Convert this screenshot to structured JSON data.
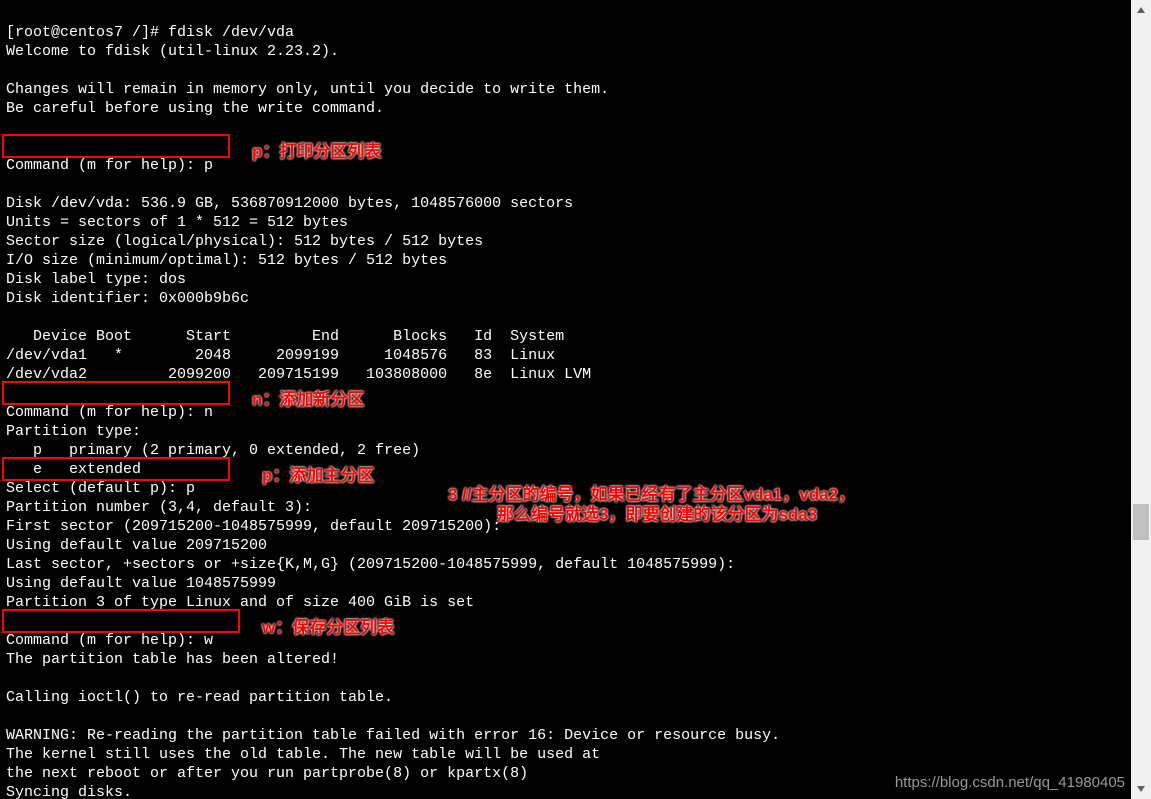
{
  "terminal": {
    "l1": "[root@centos7 /]# fdisk /dev/vda",
    "l2": "Welcome to fdisk (util-linux 2.23.2).",
    "l3": "",
    "l4": "Changes will remain in memory only, until you decide to write them.",
    "l5": "Be careful before using the write command.",
    "l6": "",
    "l7": "",
    "l8": "Command (m for help): p ",
    "l9": "",
    "l10": "Disk /dev/vda: 536.9 GB, 536870912000 bytes, 1048576000 sectors",
    "l11": "Units = sectors of 1 * 512 = 512 bytes",
    "l12": "Sector size (logical/physical): 512 bytes / 512 bytes",
    "l13": "I/O size (minimum/optimal): 512 bytes / 512 bytes",
    "l14": "Disk label type: dos",
    "l15": "Disk identifier: 0x000b9b6c",
    "l16": "",
    "l17": "   Device Boot      Start         End      Blocks   Id  System",
    "l18": "/dev/vda1   *        2048     2099199     1048576   83  Linux",
    "l19": "/dev/vda2         2099200   209715199   103808000   8e  Linux LVM",
    "l20": "",
    "l21": "Command (m for help): n ",
    "l22": "Partition type:",
    "l23": "   p   primary (2 primary, 0 extended, 2 free)",
    "l24": "   e   extended",
    "l25": "Select (default p): p ",
    "l26": "Partition number (3,4, default 3):",
    "l27": "First sector (209715200-1048575999, default 209715200):",
    "l28": "Using default value 209715200",
    "l29": "Last sector, +sectors or +size{K,M,G} (209715200-1048575999, default 1048575999):",
    "l30": "Using default value 1048575999",
    "l31": "Partition 3 of type Linux and of size 400 GiB is set",
    "l32": "",
    "l33": "Command (m for help): w ",
    "l34": "The partition table has been altered!",
    "l35": "",
    "l36": "Calling ioctl() to re-read partition table.",
    "l37": "",
    "l38": "WARNING: Re-reading the partition table failed with error 16: Device or resource busy.",
    "l39": "The kernel still uses the old table. The new table will be used at",
    "l40": "the next reboot or after you run partprobe(8) or kpartx(8)",
    "l41": "Syncing disks."
  },
  "annotations": {
    "a1": "p：打印分区列表",
    "a2": "n：添加新分区",
    "a3": "p：添加主分区",
    "a4a": "3 //主分区的编号，如果已经有了主分区vda1，vda2，",
    "a4b": "那么编号就选3，即要创建的该分区为sda3",
    "a5": "w：保存分区列表"
  },
  "watermark": "https://blog.csdn.net/qq_41980405"
}
